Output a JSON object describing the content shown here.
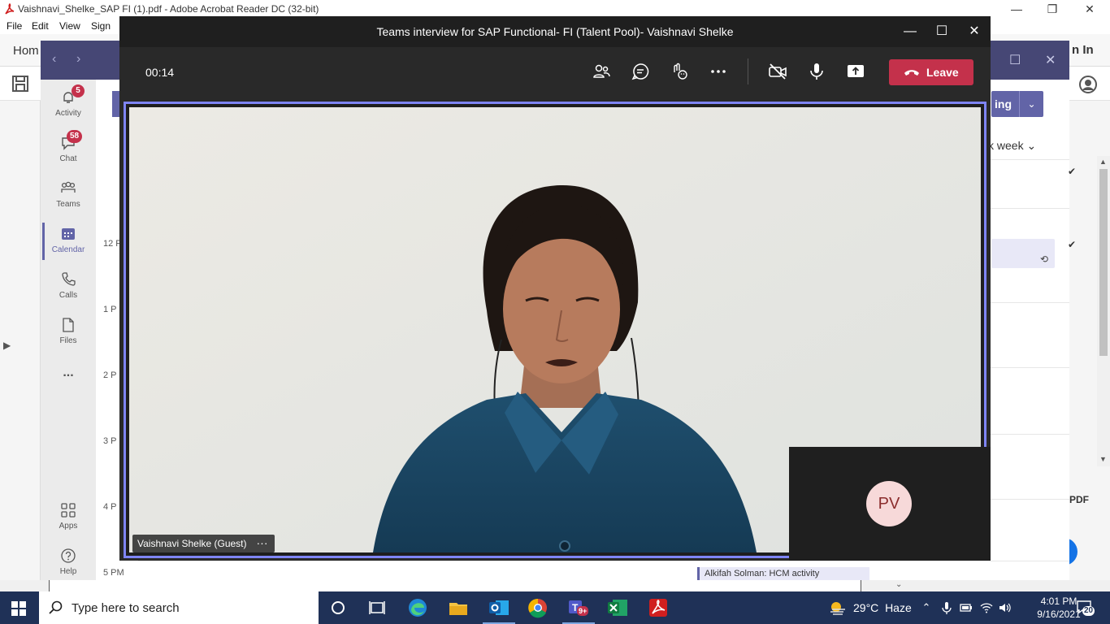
{
  "acrobat": {
    "title": "Vaishnavi_Shelke_SAP FI (1).pdf - Adobe Acrobat Reader DC (32-bit)",
    "menu": [
      "File",
      "Edit",
      "View",
      "Sign"
    ],
    "home_tab": "Hom",
    "sign_in": "n In",
    "pdf_label": "PDF"
  },
  "teams": {
    "rail": [
      {
        "label": "Activity",
        "icon": "bell-icon",
        "badge": "5"
      },
      {
        "label": "Chat",
        "icon": "chat-icon",
        "badge": "58"
      },
      {
        "label": "Teams",
        "icon": "teams-icon",
        "badge": ""
      },
      {
        "label": "Calendar",
        "icon": "calendar-icon",
        "badge": "",
        "active": true
      },
      {
        "label": "Calls",
        "icon": "phone-icon",
        "badge": ""
      },
      {
        "label": "Files",
        "icon": "file-icon",
        "badge": ""
      },
      {
        "label": "...",
        "icon": "more-icon",
        "badge": ""
      },
      {
        "label": "Apps",
        "icon": "apps-icon",
        "badge": ""
      },
      {
        "label": "Help",
        "icon": "help-icon",
        "badge": ""
      }
    ],
    "calendar": {
      "hours": [
        "12 P",
        "1 P",
        "2 P",
        "3 P",
        "4 P",
        "5 PM"
      ],
      "meet_button_partial": "ing",
      "view_label": "k week",
      "bottom_event": "Alkifah Solman: HCM activity"
    }
  },
  "meeting": {
    "title": "Teams interview for SAP Functional- FI (Talent Pool)- Vaishnavi Shelke",
    "timer": "00:14",
    "toolbar": [
      "participants-icon",
      "chat-icon",
      "reactions-icon",
      "more-icon",
      "camera-off-icon",
      "mic-icon",
      "share-icon"
    ],
    "leave_label": "Leave",
    "participant_name": "Vaishnavi Shelke (Guest)",
    "self_initials": "PV"
  },
  "taskbar": {
    "search_placeholder": "Type here to search",
    "temperature": "29°C",
    "weather": "Haze",
    "time": "4:01 PM",
    "date": "9/16/2021",
    "notification_count": "20",
    "teams_badge": "9+"
  },
  "colors": {
    "teams_purple": "#6264a7",
    "leave_red": "#c4314b",
    "active_speaker_border": "#7f85f5",
    "taskbar": "#1f3157"
  }
}
